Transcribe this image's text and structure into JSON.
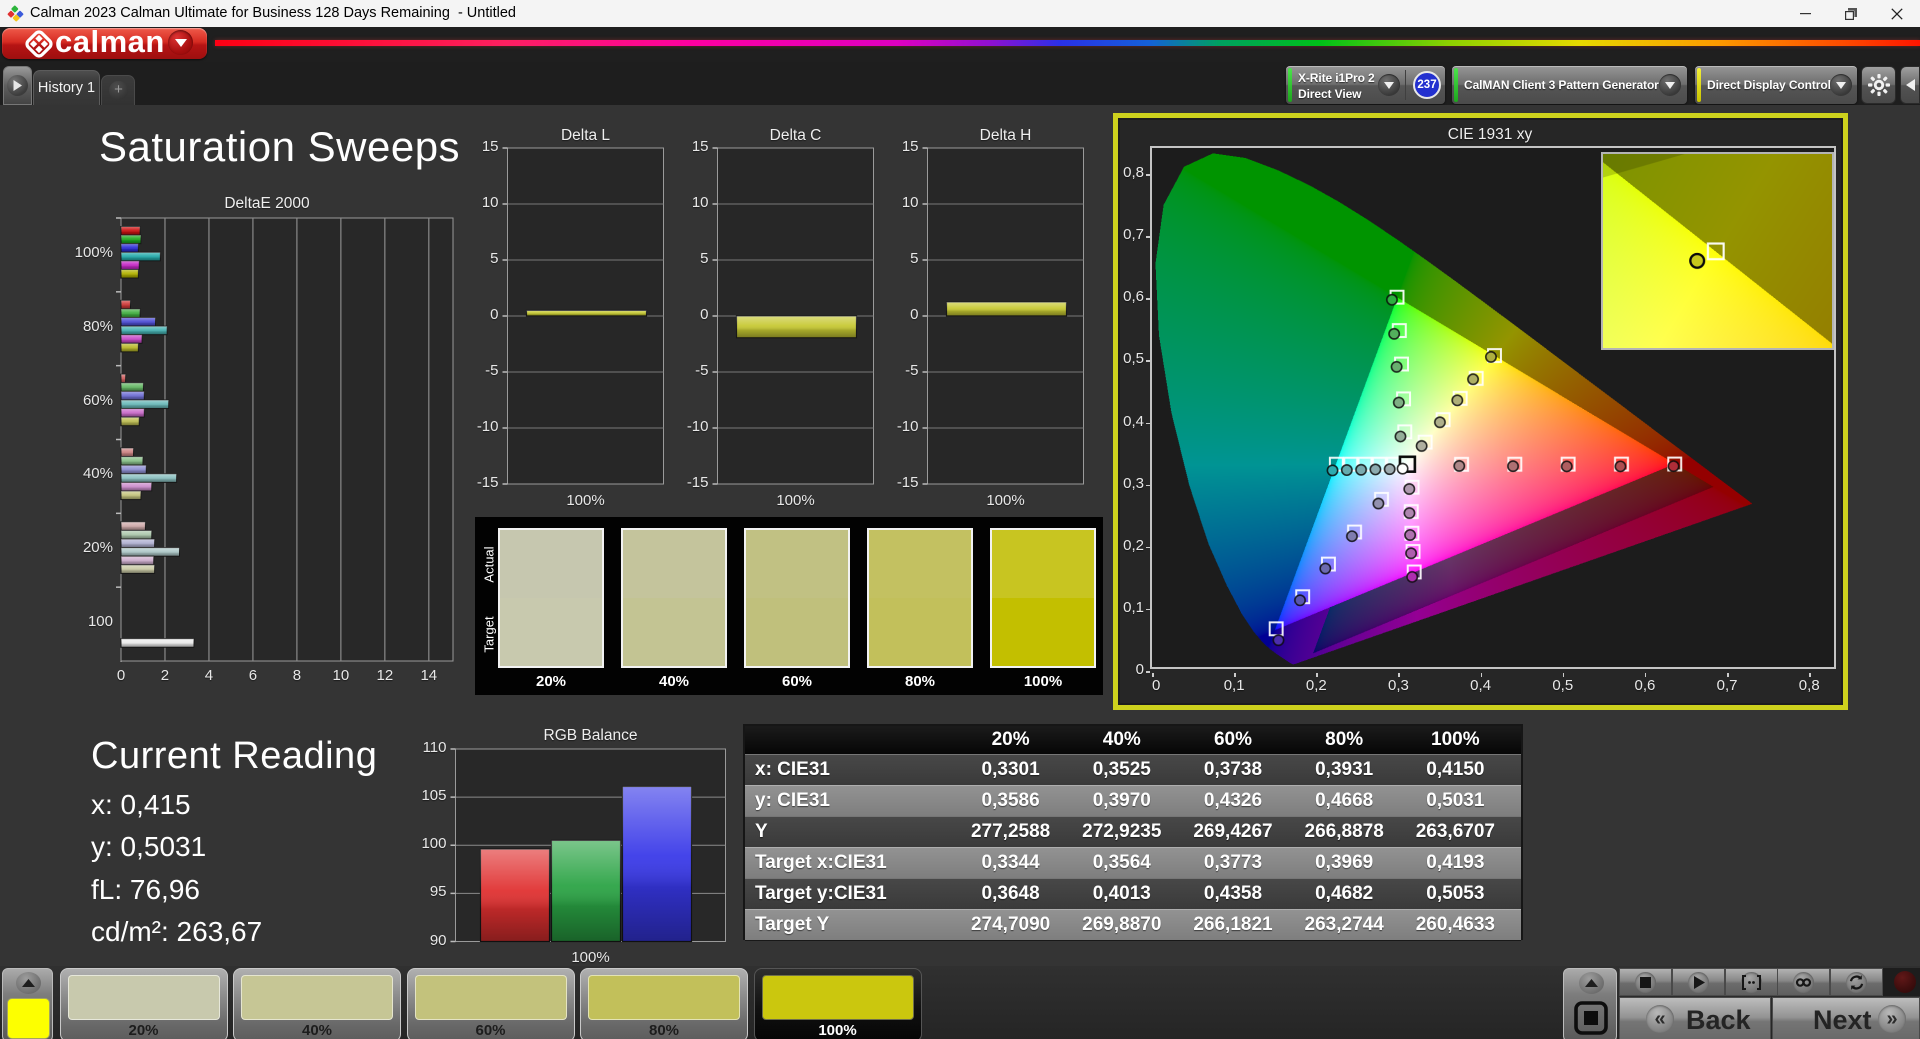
{
  "window": {
    "title": "Calman 2023 Calman Ultimate for Business 128 Days Remaining  - Untitled",
    "controls": {
      "minimize": "minimize",
      "maximize": "maximize",
      "close": "close"
    }
  },
  "brand": {
    "name": "calman"
  },
  "tabs": {
    "history": "History 1",
    "add": "+"
  },
  "toolbar": {
    "meter": {
      "line1": "X-Rite i1Pro 2",
      "line2": "Direct View",
      "badge": "237",
      "accent": "#35d435"
    },
    "pattern_generator": {
      "label": "CalMAN Client 3 Pattern Generator",
      "accent": "#35d435"
    },
    "display_control": {
      "label": "Direct Display Control",
      "accent": "#e8e400"
    }
  },
  "page": {
    "title": "Saturation Sweeps"
  },
  "chart_data": [
    {
      "id": "deltaE2000",
      "type": "bar",
      "orientation": "horizontal",
      "title": "DeltaE 2000",
      "xlabel": "",
      "ylabel": "",
      "xlim": [
        0,
        15.1
      ],
      "xticks": [
        0,
        2,
        4,
        6,
        8,
        10,
        12,
        14
      ],
      "grid": true,
      "legend": false,
      "series_order": [
        "red",
        "green",
        "blue",
        "cyan",
        "magenta",
        "yellow"
      ],
      "series_colors": [
        "#cc1212",
        "#1ea81e",
        "#2e2ed6",
        "#24aaaa",
        "#c628c6",
        "#b2b200"
      ],
      "white_bar_color": "#ebebeb",
      "groups": [
        {
          "label": "100%",
          "sat": 1.0,
          "values": [
            0.87,
            0.91,
            0.79,
            1.79,
            0.83,
            0.79
          ]
        },
        {
          "label": "80%",
          "sat": 0.8,
          "values": [
            0.43,
            0.87,
            1.57,
            2.1,
            0.96,
            0.79
          ]
        },
        {
          "label": "60%",
          "sat": 0.6,
          "values": [
            0.21,
            1.02,
            1.06,
            2.17,
            1.06,
            0.83
          ]
        },
        {
          "label": "40%",
          "sat": 0.4,
          "values": [
            0.57,
            1.0,
            1.15,
            2.53,
            1.4,
            0.91
          ]
        },
        {
          "label": "20%",
          "sat": 0.2,
          "values": [
            1.11,
            1.4,
            1.53,
            2.66,
            1.49,
            1.53
          ]
        },
        {
          "label": "100",
          "sat": 0,
          "white": true,
          "values": [
            null,
            null,
            null,
            null,
            null,
            3.32
          ]
        }
      ]
    },
    {
      "id": "deltaL",
      "type": "bar",
      "title": "Delta L",
      "categories": [
        "100%"
      ],
      "values": [
        0.5
      ],
      "ylim": [
        -15,
        15
      ],
      "yticks": [
        15,
        10,
        5,
        0,
        -5,
        -10,
        -15
      ],
      "bar_color": "#c6c832"
    },
    {
      "id": "deltaC",
      "type": "bar",
      "title": "Delta C",
      "categories": [
        "100%"
      ],
      "values": [
        -1.95
      ],
      "ylim": [
        -15,
        15
      ],
      "yticks": [
        15,
        10,
        5,
        0,
        -5,
        -10,
        -15
      ],
      "bar_color": "#c6c832"
    },
    {
      "id": "deltaH",
      "type": "bar",
      "title": "Delta H",
      "categories": [
        "100%"
      ],
      "values": [
        1.25
      ],
      "ylim": [
        -15,
        15
      ],
      "yticks": [
        15,
        10,
        5,
        0,
        -5,
        -10,
        -15
      ],
      "bar_color": "#c6c832"
    },
    {
      "id": "swatch_compare",
      "type": "table",
      "row_labels": [
        "Actual",
        "Target"
      ],
      "categories": [
        "20%",
        "40%",
        "60%",
        "80%",
        "100%"
      ],
      "actual_colors": [
        "#c6c7af",
        "#c4c49c",
        "#c1c183",
        "#c3c161",
        "#c8c521"
      ],
      "target_colors": [
        "#c8c9ae",
        "#c3c493",
        "#c0c07c",
        "#c2c05b",
        "#c3bf00"
      ]
    },
    {
      "id": "cie",
      "type": "scatter",
      "title": "CIE 1931 xy",
      "xlim": [
        0,
        0.835
      ],
      "ylim": [
        0,
        0.842
      ],
      "xticks": [
        "0",
        "0,1",
        "0,2",
        "0,3",
        "0,4",
        "0,5",
        "0,6",
        "0,7",
        "0,8"
      ],
      "yticks": [
        "0",
        "0,1",
        "0,2",
        "0,3",
        "0,4",
        "0,5",
        "0,6",
        "0,7",
        "0,8"
      ],
      "white_point": {
        "target": [
          0.3127,
          0.329
        ],
        "measured": [
          0.3068,
          0.3218
        ]
      },
      "gamut": {
        "red": [
          0.64,
          0.33
        ],
        "green": [
          0.3,
          0.6
        ],
        "blue": [
          0.15,
          0.06
        ]
      },
      "sweeps": {
        "red": {
          "targets": [
            [
              0.379,
              0.3288
            ],
            [
              0.4442,
              0.329
            ],
            [
              0.5095,
              0.3291
            ],
            [
              0.5748,
              0.3292
            ],
            [
              0.64,
              0.3293
            ]
          ],
          "measured": [
            [
              0.3762,
              0.3262
            ],
            [
              0.442,
              0.3258
            ],
            [
              0.5078,
              0.3255
            ],
            [
              0.5735,
              0.3255
            ],
            [
              0.6385,
              0.3258
            ]
          ]
        },
        "green": {
          "targets": [
            [
              0.3095,
              0.3815
            ],
            [
              0.308,
              0.435
            ],
            [
              0.3055,
              0.4915
            ],
            [
              0.3028,
              0.5458
            ],
            [
              0.3,
              0.6
            ]
          ],
          "measured": [
            [
              0.3042,
              0.374
            ],
            [
              0.3022,
              0.429
            ],
            [
              0.2995,
              0.487
            ],
            [
              0.2965,
              0.5405
            ],
            [
              0.2938,
              0.5958
            ]
          ]
        },
        "blue": {
          "targets": [
            [
              0.281,
              0.272
            ],
            [
              0.248,
              0.219
            ],
            [
              0.216,
              0.167
            ],
            [
              0.1845,
              0.114
            ],
            [
              0.152,
              0.062
            ]
          ],
          "measured": [
            [
              0.2772,
              0.2652
            ],
            [
              0.2448,
              0.2122
            ],
            [
              0.2122,
              0.1598
            ],
            [
              0.1812,
              0.1082
            ],
            [
              0.1548,
              0.0435
            ]
          ]
        },
        "cyan": {
          "targets": [
            [
              0.2257,
              0.329
            ],
            [
              0.2433,
              0.329
            ],
            [
              0.2608,
              0.329
            ],
            [
              0.2784,
              0.329
            ],
            [
              0.296,
              0.329
            ]
          ],
          "measured": [
            [
              0.221,
              0.319
            ],
            [
              0.2385,
              0.3195
            ],
            [
              0.256,
              0.32
            ],
            [
              0.2735,
              0.3205
            ],
            [
              0.291,
              0.321
            ]
          ]
        },
        "magenta": {
          "targets": [
            [
              0.3184,
              0.2917
            ],
            [
              0.3174,
              0.2522
            ],
            [
              0.3182,
              0.217
            ],
            [
              0.3196,
              0.1874
            ],
            [
              0.321,
              0.1542
            ]
          ],
          "measured": [
            [
              0.315,
              0.2888
            ],
            [
              0.3152,
              0.2498
            ],
            [
              0.316,
              0.2142
            ],
            [
              0.3172,
              0.1845
            ],
            [
              0.3185,
              0.1462
            ]
          ]
        },
        "yellow": {
          "targets": [
            [
              0.3344,
              0.3648
            ],
            [
              0.3564,
              0.4013
            ],
            [
              0.3773,
              0.4358
            ],
            [
              0.3969,
              0.4682
            ],
            [
              0.4193,
              0.5053
            ]
          ],
          "measured": [
            [
              0.3301,
              0.3586
            ],
            [
              0.3525,
              0.397
            ],
            [
              0.3738,
              0.4326
            ],
            [
              0.3931,
              0.4668
            ],
            [
              0.415,
              0.5031
            ]
          ]
        }
      },
      "inset": {
        "x_range": [
          0.3932,
          0.4462
        ],
        "y_top": 0.5279,
        "target": [
          0.4193,
          0.5053
        ],
        "measured": [
          0.415,
          0.5031
        ]
      }
    },
    {
      "id": "rgb_balance",
      "type": "bar",
      "title": "RGB Balance",
      "categories": [
        "100%"
      ],
      "xlabel": "100%",
      "ylim": [
        90,
        110
      ],
      "yticks": [
        110,
        105,
        100,
        95,
        90
      ],
      "series": [
        {
          "name": "Red",
          "values": [
            99.6
          ],
          "color": "#e03030"
        },
        {
          "name": "Green",
          "values": [
            100.5
          ],
          "color": "#2aa344"
        },
        {
          "name": "Blue",
          "values": [
            106.1
          ],
          "color": "#3838e8"
        }
      ]
    }
  ],
  "current_reading": {
    "title": "Current Reading",
    "lines": [
      "x: 0,415",
      "y: 0,5031",
      "fL: 76,96",
      "cd/m²: 263,67"
    ]
  },
  "table": {
    "columns": [
      "20%",
      "40%",
      "60%",
      "80%",
      "100%"
    ],
    "rows": [
      {
        "label": "x: CIE31",
        "values": [
          "0,3301",
          "0,3525",
          "0,3738",
          "0,3931",
          "0,4150"
        ]
      },
      {
        "label": "y: CIE31",
        "values": [
          "0,3586",
          "0,3970",
          "0,4326",
          "0,4668",
          "0,5031"
        ]
      },
      {
        "label": "Y",
        "values": [
          "277,2588",
          "272,9235",
          "269,4267",
          "266,8878",
          "263,6707"
        ]
      },
      {
        "label": "Target x:CIE31",
        "values": [
          "0,3344",
          "0,3564",
          "0,3773",
          "0,3969",
          "0,4193"
        ]
      },
      {
        "label": "Target y:CIE31",
        "values": [
          "0,3648",
          "0,4013",
          "0,4358",
          "0,4682",
          "0,5053"
        ]
      },
      {
        "label": "Target Y",
        "values": [
          "274,7090",
          "269,8870",
          "266,1821",
          "263,2744",
          "260,4633"
        ]
      }
    ]
  },
  "bottom": {
    "patch_preview_color": "#fdff00",
    "patches": [
      {
        "label": "20%",
        "color": "#c8c9ad",
        "selected": false
      },
      {
        "label": "40%",
        "color": "#c6c695",
        "selected": false
      },
      {
        "label": "60%",
        "color": "#c3c27c",
        "selected": false
      },
      {
        "label": "80%",
        "color": "#c2c05a",
        "selected": false
      },
      {
        "label": "100%",
        "color": "#cbc70e",
        "selected": true
      }
    ],
    "transport": [
      "stop",
      "play",
      "pattern-window",
      "infinity",
      "repeat"
    ],
    "back_label": "Back",
    "next_label": "Next"
  }
}
